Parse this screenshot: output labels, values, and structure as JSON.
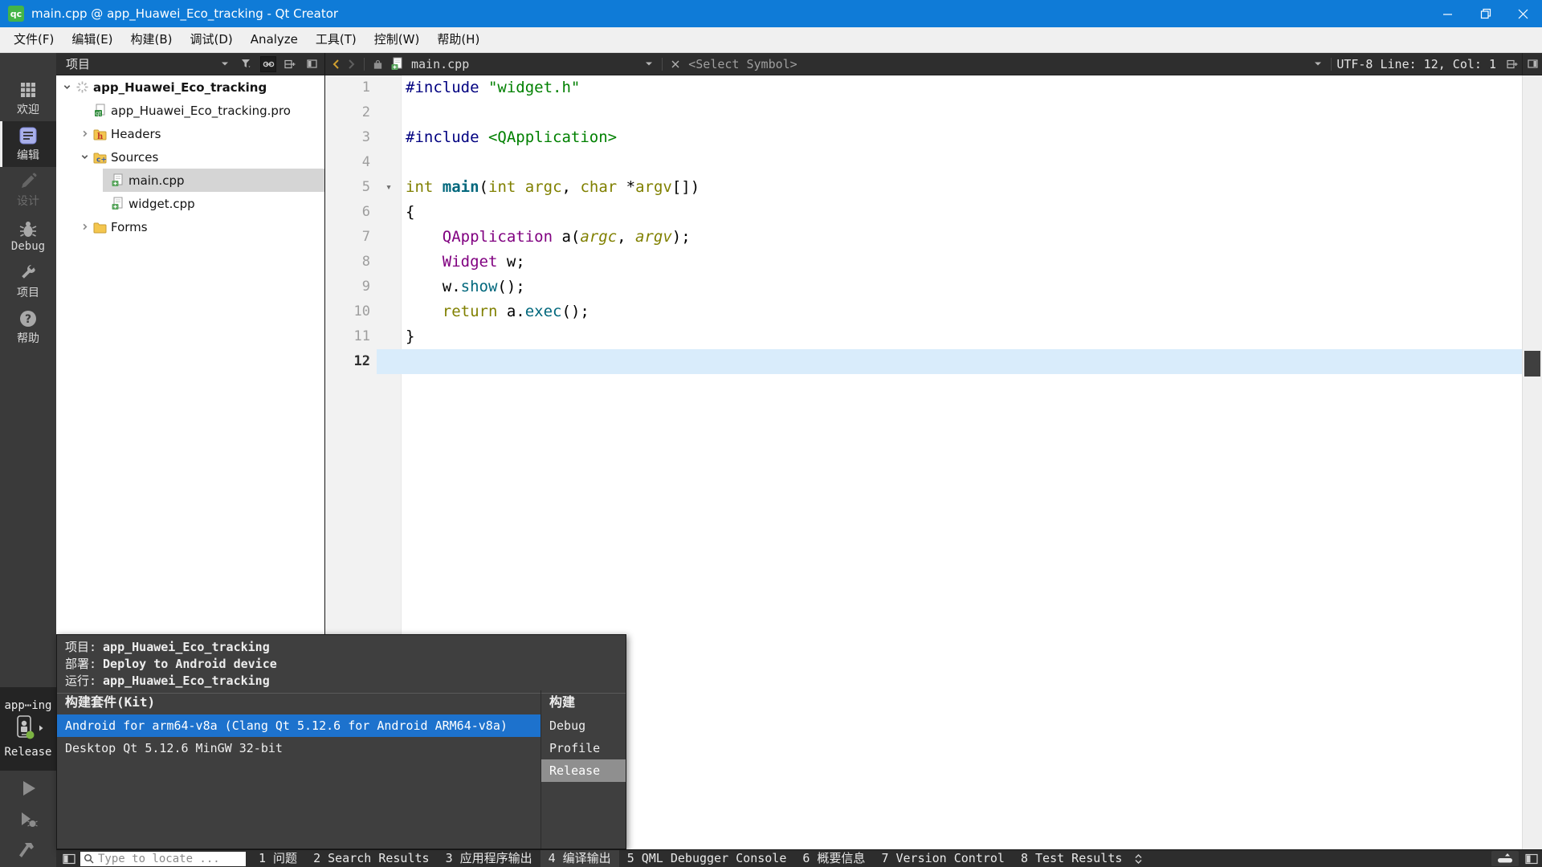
{
  "window": {
    "title": "main.cpp @ app_Huawei_Eco_tracking - Qt Creator",
    "app_badge": "qc"
  },
  "menu": {
    "items": [
      "文件(F)",
      "编辑(E)",
      "构建(B)",
      "调试(D)",
      "Analyze",
      "工具(T)",
      "控制(W)",
      "帮助(H)"
    ]
  },
  "sidebar": {
    "modes": [
      {
        "label": "欢迎",
        "icon": "welcome-grid-icon",
        "active": false,
        "disabled": false
      },
      {
        "label": "编辑",
        "icon": "edit-document-icon",
        "active": true,
        "disabled": false
      },
      {
        "label": "设计",
        "icon": "design-pencil-icon",
        "active": false,
        "disabled": true
      },
      {
        "label": "Debug",
        "icon": "debug-bug-icon",
        "active": false,
        "disabled": false
      },
      {
        "label": "项目",
        "icon": "projects-wrench-icon",
        "active": false,
        "disabled": false
      },
      {
        "label": "帮助",
        "icon": "help-circle-icon",
        "active": false,
        "disabled": false
      }
    ],
    "kit_selector": {
      "project_short": "app⋯ing",
      "build_config": "Release"
    },
    "actions": [
      {
        "name": "run-button",
        "icon": "run-play-icon"
      },
      {
        "name": "debug-run-button",
        "icon": "debug-play-icon"
      },
      {
        "name": "build-button",
        "icon": "build-hammer-icon"
      }
    ]
  },
  "project_panel": {
    "title": "项目",
    "tree": [
      {
        "label": "app_Huawei_Eco_tracking",
        "level": 0,
        "expander": "down",
        "icon": "project-spinner-icon",
        "bold": true,
        "selected": false
      },
      {
        "label": "app_Huawei_Eco_tracking.pro",
        "level": 1,
        "expander": "none",
        "icon": "pro-file-icon",
        "bold": false,
        "selected": false
      },
      {
        "label": "Headers",
        "level": 1,
        "expander": "right",
        "icon": "folder-headers-icon",
        "bold": false,
        "selected": false
      },
      {
        "label": "Sources",
        "level": 1,
        "expander": "down",
        "icon": "folder-sources-icon",
        "bold": false,
        "selected": false
      },
      {
        "label": "main.cpp",
        "level": 2,
        "expander": "none",
        "icon": "cpp-file-icon",
        "bold": false,
        "selected": true
      },
      {
        "label": "widget.cpp",
        "level": 2,
        "expander": "none",
        "icon": "cpp-file-icon",
        "bold": false,
        "selected": false
      },
      {
        "label": "Forms",
        "level": 1,
        "expander": "right",
        "icon": "folder-forms-icon",
        "bold": false,
        "selected": false
      }
    ]
  },
  "editor": {
    "tab": {
      "file": "main.cpp",
      "symbol_selector": "<Select Symbol>"
    },
    "status_text": "UTF-8 Line: 12, Col: 1",
    "current_line": 12,
    "lines": [
      {
        "num": 1,
        "segments": [
          {
            "t": "#include ",
            "c": "pre"
          },
          {
            "t": "\"widget.h\"",
            "c": "str"
          }
        ]
      },
      {
        "num": 2,
        "segments": []
      },
      {
        "num": 3,
        "segments": [
          {
            "t": "#include ",
            "c": "pre"
          },
          {
            "t": "<QApplication>",
            "c": "str"
          }
        ]
      },
      {
        "num": 4,
        "segments": []
      },
      {
        "num": 5,
        "fold": true,
        "segments": [
          {
            "t": "int",
            "c": "kw"
          },
          {
            "t": " "
          },
          {
            "t": "main",
            "c": "mainfn"
          },
          {
            "t": "("
          },
          {
            "t": "int",
            "c": "kw"
          },
          {
            "t": " "
          },
          {
            "t": "argc",
            "c": "arg"
          },
          {
            "t": ", "
          },
          {
            "t": "char",
            "c": "kw"
          },
          {
            "t": " *"
          },
          {
            "t": "argv",
            "c": "arg"
          },
          {
            "t": "[])"
          }
        ]
      },
      {
        "num": 6,
        "segments": [
          {
            "t": "{"
          }
        ]
      },
      {
        "num": 7,
        "segments": [
          {
            "t": "    "
          },
          {
            "t": "QApplication",
            "c": "type"
          },
          {
            "t": " a("
          },
          {
            "t": "argc",
            "c": "argi"
          },
          {
            "t": ", "
          },
          {
            "t": "argv",
            "c": "argi"
          },
          {
            "t": ");"
          }
        ]
      },
      {
        "num": 8,
        "segments": [
          {
            "t": "    "
          },
          {
            "t": "Widget",
            "c": "type"
          },
          {
            "t": " w;"
          }
        ]
      },
      {
        "num": 9,
        "segments": [
          {
            "t": "    w."
          },
          {
            "t": "show",
            "c": "fn"
          },
          {
            "t": "();"
          }
        ]
      },
      {
        "num": 10,
        "segments": [
          {
            "t": "    "
          },
          {
            "t": "return",
            "c": "kw"
          },
          {
            "t": " a."
          },
          {
            "t": "exec",
            "c": "fn"
          },
          {
            "t": "();"
          }
        ]
      },
      {
        "num": 11,
        "segments": [
          {
            "t": "}"
          }
        ]
      },
      {
        "num": 12,
        "segments": []
      }
    ]
  },
  "kit_popup": {
    "info": [
      {
        "label": "项目:",
        "value": "app_Huawei_Eco_tracking"
      },
      {
        "label": "部署:",
        "value": "Deploy to Android device"
      },
      {
        "label": "运行:",
        "value": "app_Huawei_Eco_tracking"
      }
    ],
    "kit_header": "构建套件(Kit)",
    "build_header": "构建",
    "kits": [
      {
        "label": "Android for arm64-v8a (Clang Qt 5.12.6 for Android ARM64-v8a)",
        "selected": true
      },
      {
        "label": "Desktop Qt 5.12.6 MinGW 32-bit",
        "selected": false
      }
    ],
    "builds": [
      {
        "label": "Debug",
        "selected": false
      },
      {
        "label": "Profile",
        "selected": false
      },
      {
        "label": "Release",
        "selected": true
      }
    ]
  },
  "statusbar": {
    "locator_placeholder": "Type to locate ...",
    "panes": [
      {
        "label": "1 问题",
        "active": false
      },
      {
        "label": "2 Search Results",
        "active": false
      },
      {
        "label": "3 应用程序输出",
        "active": false
      },
      {
        "label": "4 编译输出",
        "active": true
      },
      {
        "label": "5 QML Debugger Console",
        "active": false
      },
      {
        "label": "6 概要信息",
        "active": false
      },
      {
        "label": "7 Version Control",
        "active": false
      },
      {
        "label": "8 Test Results",
        "active": false
      }
    ]
  },
  "colors": {
    "titlebar_blue": "#0f7bd7",
    "selection_blue": "#1d72cd",
    "release_selected_gray": "#8f8f8f",
    "current_line_blue": "#d9ecfb",
    "qt_green": "#44b549",
    "keyword_olive": "#808000",
    "type_purple": "#800080",
    "string_green": "#008000",
    "preprocessor_navy": "#000080",
    "function_teal": "#00677c"
  }
}
